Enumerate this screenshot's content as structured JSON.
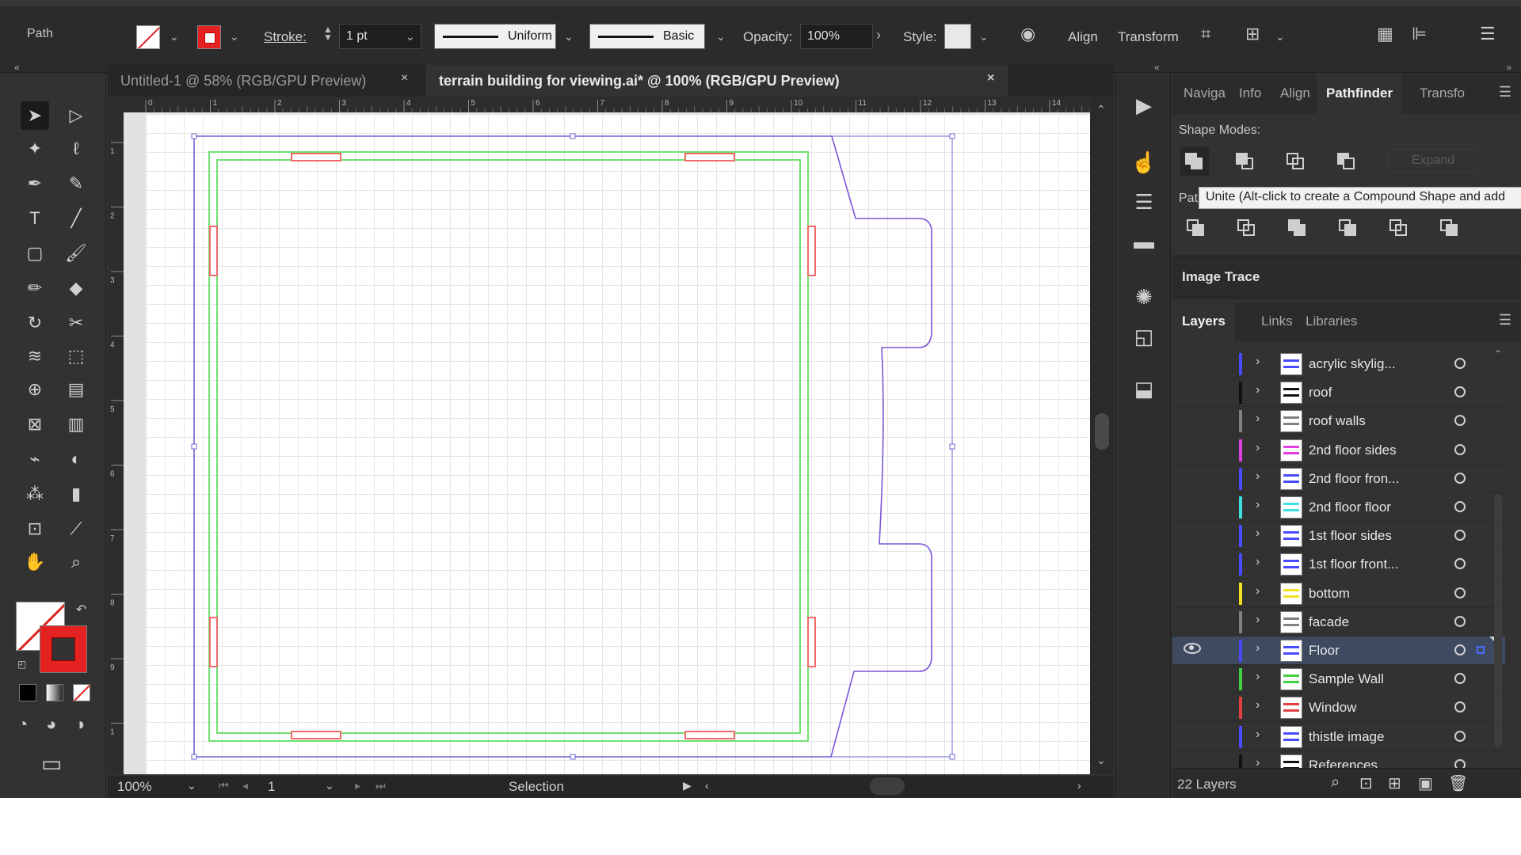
{
  "control_bar": {
    "selection_type": "Path",
    "stroke_label": "Stroke:",
    "stroke_weight": "1 pt",
    "profile_label": "Uniform",
    "brush_label": "Basic",
    "opacity_label": "Opacity:",
    "opacity_value": "100%",
    "style_label": "Style:",
    "align_label": "Align",
    "transform_label": "Transform",
    "fill_color": "#ffffff",
    "stroke_color": "#e52222"
  },
  "document_tabs": [
    {
      "label": "Untitled-1 @ 58% (RGB/GPU Preview)",
      "active": false
    },
    {
      "label": "terrain building for viewing.ai* @ 100% (RGB/GPU Preview)",
      "active": true
    }
  ],
  "tab_close_glyph": "×",
  "ruler": {
    "h_ticks": [
      "0",
      "1",
      "2",
      "3",
      "4",
      "5",
      "6",
      "7",
      "8",
      "9",
      "10",
      "11",
      "12",
      "13",
      "14"
    ],
    "v_ticks": [
      "1",
      "2",
      "3",
      "4",
      "5",
      "6",
      "7",
      "8",
      "9",
      "1"
    ]
  },
  "status_bar": {
    "zoom": "100%",
    "artboard_number": "1",
    "tool_status": "Selection"
  },
  "panel_tabs": [
    "Naviga",
    "Info",
    "Align",
    "Pathfinder",
    "Transfo"
  ],
  "pathfinder": {
    "shape_modes_label": "Shape Modes:",
    "expand_label": "Expand",
    "pathfinders_label": "Pat",
    "tooltip": "Unite (Alt-click to create a Compound Shape and add"
  },
  "image_trace": {
    "title": "Image Trace"
  },
  "layer_tabs": [
    "Layers",
    "Links",
    "Libraries"
  ],
  "layers": [
    {
      "name": "acrylic skylig...",
      "color": "#4a4aff",
      "visible": false,
      "selected": false
    },
    {
      "name": "roof",
      "color": "#111111",
      "visible": false,
      "selected": false
    },
    {
      "name": "roof walls",
      "color": "#808080",
      "visible": false,
      "selected": false
    },
    {
      "name": "2nd floor sides",
      "color": "#e040e0",
      "visible": false,
      "selected": false
    },
    {
      "name": "2nd floor fron...",
      "color": "#4a4aff",
      "visible": false,
      "selected": false
    },
    {
      "name": "2nd floor floor",
      "color": "#40e0e0",
      "visible": false,
      "selected": false
    },
    {
      "name": "1st floor sides",
      "color": "#4a4aff",
      "visible": false,
      "selected": false
    },
    {
      "name": "1st floor front...",
      "color": "#4a4aff",
      "visible": false,
      "selected": false
    },
    {
      "name": "bottom",
      "color": "#f0e020",
      "visible": false,
      "selected": false
    },
    {
      "name": "facade",
      "color": "#808080",
      "visible": false,
      "selected": false
    },
    {
      "name": "Floor",
      "color": "#4a4aff",
      "visible": true,
      "selected": true
    },
    {
      "name": "Sample Wall",
      "color": "#40d040",
      "visible": false,
      "selected": false
    },
    {
      "name": "Window",
      "color": "#e04040",
      "visible": false,
      "selected": false
    },
    {
      "name": "thistle image",
      "color": "#4a4aff",
      "visible": false,
      "selected": false
    },
    {
      "name": "References",
      "color": "#111111",
      "visible": false,
      "selected": false
    }
  ],
  "layers_count": "22 Layers",
  "colors": {
    "floor_path": "#7b55d6",
    "wall_path": "#6fe06f",
    "window_path": "#f26b6b",
    "selection": "#6a6ad0"
  }
}
